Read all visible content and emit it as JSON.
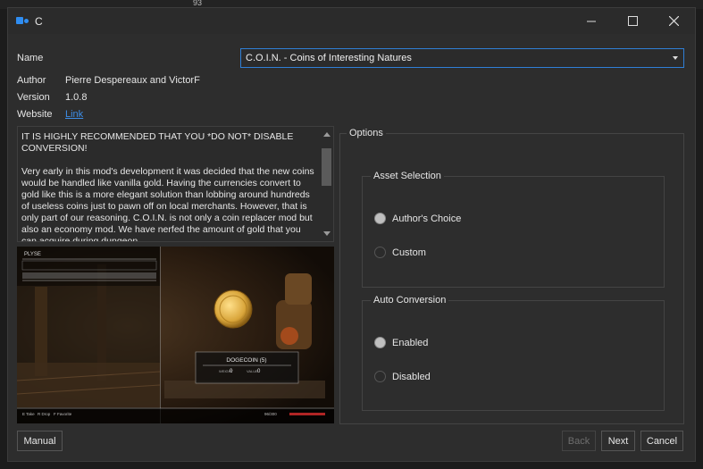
{
  "background": {
    "number": "93"
  },
  "window": {
    "title": "C"
  },
  "fields": {
    "name_label": "Name",
    "name_value": "C.O.I.N. - Coins of Interesting Natures",
    "author_label": "Author",
    "author_value": "Pierre Despereaux and VictorF",
    "version_label": "Version",
    "version_value": "1.0.8",
    "website_label": "Website",
    "website_value": "Link"
  },
  "description": "IT IS HIGHLY RECOMMENDED THAT YOU *DO NOT* DISABLE CONVERSION!\n\nVery early in this mod's development it was decided that the new coins would be handled like vanilla gold. Having the currencies convert to gold like this is a more elegant solution than lobbing around hundreds of useless coins just to pawn off on local merchants. However, that is only part of our reasoning. C.O.I.N. is not only a coin replacer mod but also an economy mod. We have nerfed the amount of gold that you can acquire during dungeon",
  "preview": {
    "hud_title": "PLYSE",
    "item_label": "DOGECOIN (5)",
    "weight_label": "WEIGHT",
    "weight_value": "0",
    "value_label": "VALUE",
    "value_value": "0",
    "bottom_actions": [
      "E Take",
      "R Drop",
      "F Favorite"
    ],
    "gold": "96/300"
  },
  "options": {
    "title": "Options",
    "asset_selection": {
      "title": "Asset Selection",
      "choices": [
        {
          "label": "Author's Choice",
          "checked": true
        },
        {
          "label": "Custom",
          "checked": false
        }
      ]
    },
    "auto_conversion": {
      "title": "Auto Conversion",
      "choices": [
        {
          "label": "Enabled",
          "checked": true
        },
        {
          "label": "Disabled",
          "checked": false
        }
      ]
    }
  },
  "buttons": {
    "manual": "Manual",
    "back": "Back",
    "next": "Next",
    "cancel": "Cancel"
  }
}
